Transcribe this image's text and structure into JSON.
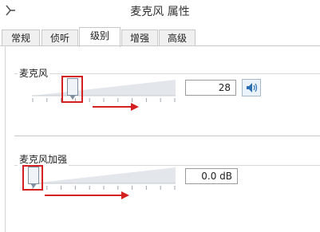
{
  "window": {
    "title": "麦克风 属性",
    "icon": "microphone-icon"
  },
  "tabs": [
    {
      "label": "常规",
      "active": false
    },
    {
      "label": "侦听",
      "active": false
    },
    {
      "label": "级别",
      "active": true
    },
    {
      "label": "增强",
      "active": false
    },
    {
      "label": "高级",
      "active": false
    }
  ],
  "microphone": {
    "label": "麦克风",
    "value": "28",
    "level_fraction": 0.28,
    "speaker_icon": "speaker-icon"
  },
  "boost": {
    "label": "麦克风加强",
    "value": "0.0 dB",
    "level_fraction": 0.0
  },
  "colors": {
    "highlight": "#d42020",
    "arrow": "#d42020"
  }
}
